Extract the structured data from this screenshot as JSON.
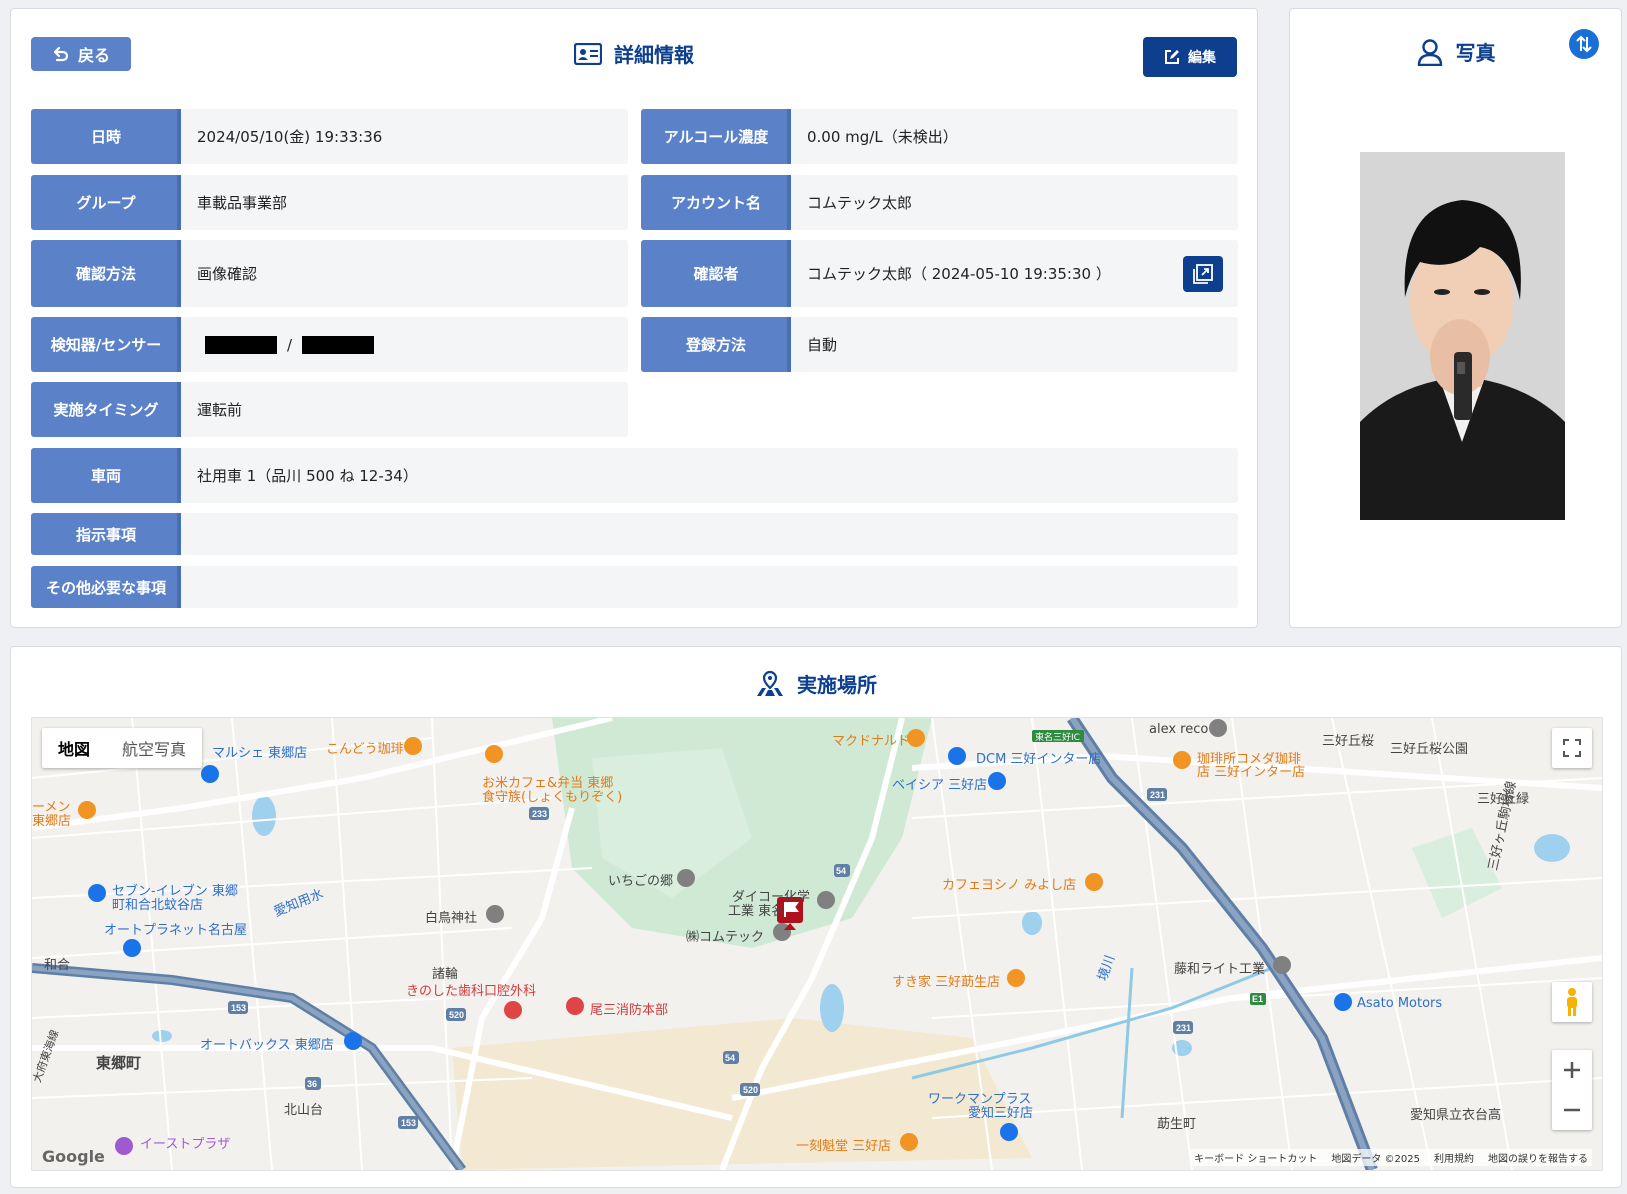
{
  "detail": {
    "back_label": "戻る",
    "title": "詳細情報",
    "edit_label": "編集",
    "rows": {
      "datetime": {
        "label": "日時",
        "value": "2024/05/10(金) 19:33:36"
      },
      "alcohol": {
        "label": "アルコール濃度",
        "value": "0.00 mg/L（未検出）"
      },
      "group": {
        "label": "グループ",
        "value": "車載品事業部"
      },
      "account": {
        "label": "アカウント名",
        "value": "コムテック太郎"
      },
      "method": {
        "label": "確認方法",
        "value": "画像確認"
      },
      "confirmer": {
        "label": "確認者",
        "value": "コムテック太郎（ 2024-05-10 19:35:30 ）"
      },
      "detector": {
        "label": "検知器/センサー",
        "separator": "/"
      },
      "registration": {
        "label": "登録方法",
        "value": "自動"
      },
      "timing": {
        "label": "実施タイミング",
        "value": "運転前"
      },
      "vehicle": {
        "label": "車両",
        "value": "社用車 1（品川 500 ね 12-34）"
      },
      "instructions": {
        "label": "指示事項",
        "value": ""
      },
      "other": {
        "label": "その他必要な事項",
        "value": ""
      }
    }
  },
  "photo": {
    "title": "写真"
  },
  "map_section": {
    "title": "実施場所",
    "map_type": {
      "map": "地図",
      "satellite": "航空写真"
    },
    "labels": {
      "l1": "マルシェ 東郷店",
      "l2": "こんどう珈琲",
      "l3": "お米カフェ&弁当 東郷",
      "l4": "食守族(しょくもりぞく)",
      "l5": "マクドナルド",
      "l6": "DCM 三好インター店",
      "l7": "ベイシア 三好店",
      "l8": "alex reco",
      "l9": "珈琲所コメダ珈琲",
      "l10": "店 三好インター店",
      "l11": "三好丘桜",
      "l12": "三好丘桜公園",
      "l13": "三好丘緑",
      "l14": "ーメン",
      "l15": "東郷店",
      "l16": "セブン-イレブン 東郷",
      "l17": "町和合北蚊谷店",
      "l18": "オートプラネット名古屋",
      "l19": "愛知用水",
      "l20": "白鳥神社",
      "l21": "いちごの郷",
      "l22": "ダイコー化学",
      "l23": "工業 東名",
      "l24": "㈱コムテック",
      "l25": "カフェヨシノ みよし店",
      "l26": "和合",
      "l27": "諸輪",
      "l28": "きのした歯科口腔外科",
      "l29": "尾三消防本部",
      "l30": "すき家 三好莇生店",
      "l31": "藤和ライト工業",
      "l32": "Asato Motors",
      "l33": "東郷町",
      "l34": "オートバックス 東郷店",
      "l35": "北山台",
      "l36": "ワークマンプラス",
      "l37": "愛知三好店",
      "l38": "莇生町",
      "l39": "愛知県立衣台高",
      "l40": "一刻魁堂 三好店",
      "l41": "イーストプラザ",
      "l42": "東名三好IC",
      "l43": "三好ヶ丘駒場線",
      "l44": "境川",
      "l45": "大府東海線"
    },
    "footer": {
      "google": "Google",
      "shortcuts": "キーボード ショートカット",
      "mapdata": "地図データ ©2025",
      "terms": "利用規約",
      "report": "地図の誤りを報告する"
    }
  }
}
